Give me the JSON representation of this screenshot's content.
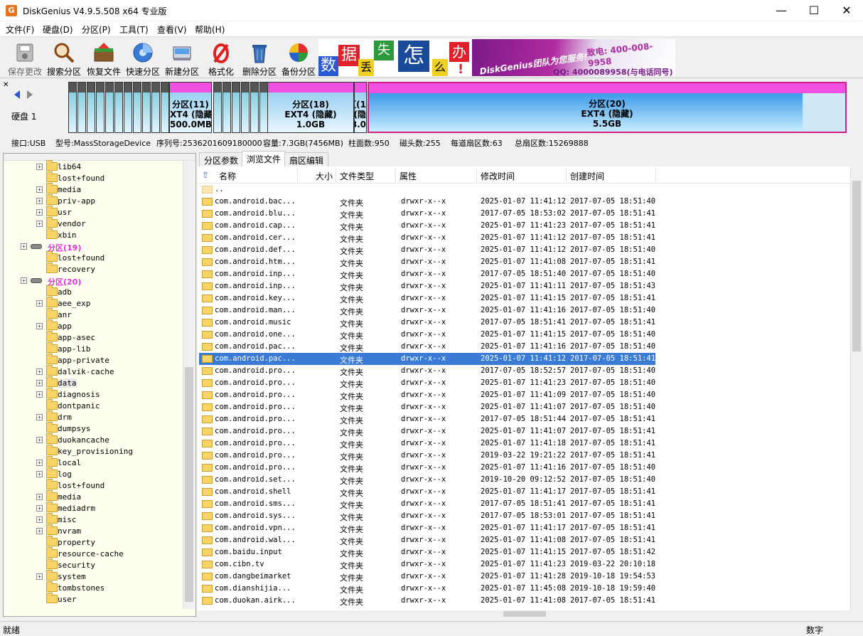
{
  "window": {
    "title": "DiskGenius V4.9.5.508 x64 专业版",
    "icon_text": "G",
    "minimize": "—",
    "maximize": "☐",
    "close": "✕"
  },
  "menu": [
    "文件(F)",
    "硬盘(D)",
    "分区(P)",
    "工具(T)",
    "查看(V)",
    "帮助(H)"
  ],
  "toolbar": [
    {
      "label": "保存更改",
      "icon": "save-icon",
      "disabled": true
    },
    {
      "label": "搜索分区",
      "icon": "search-partition-icon"
    },
    {
      "label": "恢复文件",
      "icon": "recover-files-icon"
    },
    {
      "label": "快速分区",
      "icon": "quick-partition-icon"
    },
    {
      "label": "新建分区",
      "icon": "new-partition-icon"
    },
    {
      "label": "格式化",
      "icon": "format-icon"
    },
    {
      "label": "删除分区",
      "icon": "delete-partition-icon"
    },
    {
      "label": "备份分区",
      "icon": "backup-partition-icon"
    }
  ],
  "banner": {
    "chars": [
      "数",
      "据",
      "丢",
      "失",
      "怎",
      "么",
      "办",
      "!"
    ],
    "team": "DiskGenius团队为您服务!",
    "tel": "致电: 400-008-9958",
    "qq": "QQ: 4000089958(与电话同号)"
  },
  "disk": {
    "label": "硬盘 1",
    "partitions": [
      {
        "name": "分区(11)",
        "fs": "XT4 (隐藏",
        "size": "500.0MB"
      },
      {
        "name": "分区(18)",
        "fs": "EXT4 (隐藏)",
        "size": "1.0GB"
      },
      {
        "name": "区(1",
        "fs": "4 (隐",
        "size": "8.0"
      },
      {
        "name": "分区(20)",
        "fs": "EXT4 (隐藏)",
        "size": "5.5GB"
      }
    ],
    "info": [
      "接口:USB",
      "型号:MassStorageDevice",
      "序列号:2536201609180000",
      "容量:7.3GB(7456MB)",
      "柱面数:950",
      "磁头数:255",
      "每道扇区数:63",
      "总扇区数:15269888"
    ]
  },
  "tree": [
    {
      "label": "lib64",
      "depth": 2,
      "exp": true
    },
    {
      "label": "lost+found",
      "depth": 2,
      "exp": false
    },
    {
      "label": "media",
      "depth": 2,
      "exp": true
    },
    {
      "label": "priv-app",
      "depth": 2,
      "exp": true
    },
    {
      "label": "usr",
      "depth": 2,
      "exp": true
    },
    {
      "label": "vendor",
      "depth": 2,
      "exp": true
    },
    {
      "label": "xbin",
      "depth": 2,
      "exp": false
    },
    {
      "label": "分区(19)",
      "depth": 1,
      "exp": true,
      "part": true
    },
    {
      "label": "lost+found",
      "depth": 2,
      "exp": false
    },
    {
      "label": "recovery",
      "depth": 2,
      "exp": false
    },
    {
      "label": "分区(20)",
      "depth": 1,
      "exp": true,
      "part": true
    },
    {
      "label": "adb",
      "depth": 2,
      "exp": false
    },
    {
      "label": "aee_exp",
      "depth": 2,
      "exp": true
    },
    {
      "label": "anr",
      "depth": 2,
      "exp": false
    },
    {
      "label": "app",
      "depth": 2,
      "exp": true
    },
    {
      "label": "app-asec",
      "depth": 2,
      "exp": false
    },
    {
      "label": "app-lib",
      "depth": 2,
      "exp": false
    },
    {
      "label": "app-private",
      "depth": 2,
      "exp": false
    },
    {
      "label": "dalvik-cache",
      "depth": 2,
      "exp": true
    },
    {
      "label": "data",
      "depth": 2,
      "exp": true,
      "sel": true
    },
    {
      "label": "diagnosis",
      "depth": 2,
      "exp": true
    },
    {
      "label": "dontpanic",
      "depth": 2,
      "exp": false
    },
    {
      "label": "drm",
      "depth": 2,
      "exp": true
    },
    {
      "label": "dumpsys",
      "depth": 2,
      "exp": false
    },
    {
      "label": "duokancache",
      "depth": 2,
      "exp": true
    },
    {
      "label": "key_provisioning",
      "depth": 2,
      "exp": false
    },
    {
      "label": "local",
      "depth": 2,
      "exp": true
    },
    {
      "label": "log",
      "depth": 2,
      "exp": true
    },
    {
      "label": "lost+found",
      "depth": 2,
      "exp": false
    },
    {
      "label": "media",
      "depth": 2,
      "exp": true
    },
    {
      "label": "mediadrm",
      "depth": 2,
      "exp": true
    },
    {
      "label": "misc",
      "depth": 2,
      "exp": true
    },
    {
      "label": "nvram",
      "depth": 2,
      "exp": true
    },
    {
      "label": "property",
      "depth": 2,
      "exp": false
    },
    {
      "label": "resource-cache",
      "depth": 2,
      "exp": false
    },
    {
      "label": "security",
      "depth": 2,
      "exp": false
    },
    {
      "label": "system",
      "depth": 2,
      "exp": true
    },
    {
      "label": "tombstones",
      "depth": 2,
      "exp": false
    },
    {
      "label": "user",
      "depth": 2,
      "exp": false
    }
  ],
  "tabs": [
    "分区参数",
    "浏览文件",
    "扇区编辑"
  ],
  "active_tab": 1,
  "columns": [
    "名称",
    "大小",
    "文件类型",
    "属性",
    "修改时间",
    "创建时间"
  ],
  "up_dir": "..",
  "files": [
    [
      "com.android.bac...",
      "文件夹",
      "drwxr-x--x",
      "2025-01-07 11:41:12",
      "2017-07-05 18:51:40"
    ],
    [
      "com.android.blu...",
      "文件夹",
      "drwxr-x--x",
      "2017-07-05 18:53:02",
      "2017-07-05 18:51:41"
    ],
    [
      "com.android.cap...",
      "文件夹",
      "drwxr-x--x",
      "2025-01-07 11:41:23",
      "2017-07-05 18:51:41"
    ],
    [
      "com.android.cer...",
      "文件夹",
      "drwxr-x--x",
      "2025-01-07 11:41:12",
      "2017-07-05 18:51:41"
    ],
    [
      "com.android.def...",
      "文件夹",
      "drwxr-x--x",
      "2025-01-07 11:41:12",
      "2017-07-05 18:51:40"
    ],
    [
      "com.android.htm...",
      "文件夹",
      "drwxr-x--x",
      "2025-01-07 11:41:08",
      "2017-07-05 18:51:41"
    ],
    [
      "com.android.inp...",
      "文件夹",
      "drwxr-x--x",
      "2017-07-05 18:51:40",
      "2017-07-05 18:51:40"
    ],
    [
      "com.android.inp...",
      "文件夹",
      "drwxr-x--x",
      "2025-01-07 11:41:11",
      "2017-07-05 18:51:43"
    ],
    [
      "com.android.key...",
      "文件夹",
      "drwxr-x--x",
      "2025-01-07 11:41:15",
      "2017-07-05 18:51:41"
    ],
    [
      "com.android.man...",
      "文件夹",
      "drwxr-x--x",
      "2025-01-07 11:41:16",
      "2017-07-05 18:51:40"
    ],
    [
      "com.android.music",
      "文件夹",
      "drwxr-x--x",
      "2017-07-05 18:51:41",
      "2017-07-05 18:51:41"
    ],
    [
      "com.android.one...",
      "文件夹",
      "drwxr-x--x",
      "2025-01-07 11:41:15",
      "2017-07-05 18:51:40"
    ],
    [
      "com.android.pac...",
      "文件夹",
      "drwxr-x--x",
      "2025-01-07 11:41:16",
      "2017-07-05 18:51:40"
    ],
    [
      "com.android.pac...",
      "文件夹",
      "drwxr-x--x",
      "2025-01-07 11:41:12",
      "2017-07-05 18:51:41"
    ],
    [
      "com.android.pro...",
      "文件夹",
      "drwxr-x--x",
      "2017-07-05 18:52:57",
      "2017-07-05 18:51:40"
    ],
    [
      "com.android.pro...",
      "文件夹",
      "drwxr-x--x",
      "2025-01-07 11:41:23",
      "2017-07-05 18:51:40"
    ],
    [
      "com.android.pro...",
      "文件夹",
      "drwxr-x--x",
      "2025-01-07 11:41:09",
      "2017-07-05 18:51:40"
    ],
    [
      "com.android.pro...",
      "文件夹",
      "drwxr-x--x",
      "2025-01-07 11:41:07",
      "2017-07-05 18:51:40"
    ],
    [
      "com.android.pro...",
      "文件夹",
      "drwxr-x--x",
      "2017-07-05 18:51:44",
      "2017-07-05 18:51:41"
    ],
    [
      "com.android.pro...",
      "文件夹",
      "drwxr-x--x",
      "2025-01-07 11:41:07",
      "2017-07-05 18:51:41"
    ],
    [
      "com.android.pro...",
      "文件夹",
      "drwxr-x--x",
      "2025-01-07 11:41:18",
      "2017-07-05 18:51:41"
    ],
    [
      "com.android.pro...",
      "文件夹",
      "drwxr-x--x",
      "2019-03-22 19:21:22",
      "2017-07-05 18:51:41"
    ],
    [
      "com.android.pro...",
      "文件夹",
      "drwxr-x--x",
      "2025-01-07 11:41:16",
      "2017-07-05 18:51:40"
    ],
    [
      "com.android.set...",
      "文件夹",
      "drwxr-x--x",
      "2019-10-20 09:12:52",
      "2017-07-05 18:51:40"
    ],
    [
      "com.android.shell",
      "文件夹",
      "drwxr-x--x",
      "2025-01-07 11:41:17",
      "2017-07-05 18:51:41"
    ],
    [
      "com.android.sms...",
      "文件夹",
      "drwxr-x--x",
      "2017-07-05 18:51:41",
      "2017-07-05 18:51:41"
    ],
    [
      "com.android.sys...",
      "文件夹",
      "drwxr-x--x",
      "2017-07-05 18:53:01",
      "2017-07-05 18:51:41"
    ],
    [
      "com.android.vpn...",
      "文件夹",
      "drwxr-x--x",
      "2025-01-07 11:41:17",
      "2017-07-05 18:51:41"
    ],
    [
      "com.android.wal...",
      "文件夹",
      "drwxr-x--x",
      "2025-01-07 11:41:08",
      "2017-07-05 18:51:41"
    ],
    [
      "com.baidu.input",
      "文件夹",
      "drwxr-x--x",
      "2025-01-07 11:41:15",
      "2017-07-05 18:51:42"
    ],
    [
      "com.cibn.tv",
      "文件夹",
      "drwxr-x--x",
      "2025-01-07 11:41:23",
      "2019-03-22 20:10:18"
    ],
    [
      "com.dangbeimarket",
      "文件夹",
      "drwxr-x--x",
      "2025-01-07 11:41:28",
      "2019-10-18 19:54:53"
    ],
    [
      "com.dianshijia...",
      "文件夹",
      "drwxr-x--x",
      "2025-01-07 11:45:08",
      "2019-10-18 19:59:40"
    ],
    [
      "com.duokan.airk...",
      "文件夹",
      "drwxr-x--x",
      "2025-01-07 11:41:08",
      "2017-07-05 18:51:41"
    ]
  ],
  "selected_file": 13,
  "status": {
    "left": "就绪",
    "right": "数字"
  }
}
